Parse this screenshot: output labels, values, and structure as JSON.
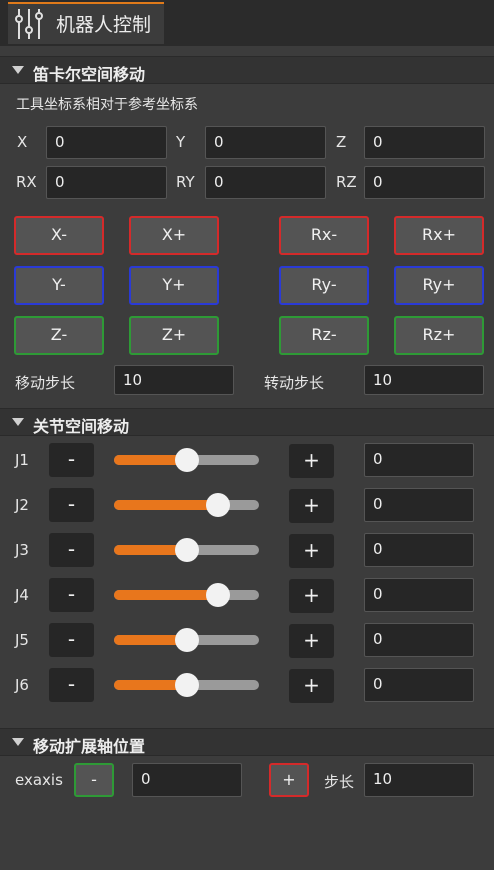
{
  "window": {
    "tab_title": "机器人控制"
  },
  "cartesian": {
    "title": "笛卡尔空间移动",
    "subtitle": "工具坐标系相对于参考坐标系",
    "coords": [
      {
        "label": "X",
        "value": "0"
      },
      {
        "label": "Y",
        "value": "0"
      },
      {
        "label": "Z",
        "value": "0"
      },
      {
        "label": "RX",
        "value": "0"
      },
      {
        "label": "RY",
        "value": "0"
      },
      {
        "label": "RZ",
        "value": "0"
      }
    ],
    "buttons": {
      "x_minus": "X-",
      "x_plus": "X+",
      "rx_minus": "Rx-",
      "rx_plus": "Rx+",
      "y_minus": "Y-",
      "y_plus": "Y+",
      "ry_minus": "Ry-",
      "ry_plus": "Ry+",
      "z_minus": "Z-",
      "z_plus": "Z+",
      "rz_minus": "Rz-",
      "rz_plus": "Rz+"
    },
    "move_step_label": "移动步长",
    "move_step_value": "10",
    "rotate_step_label": "转动步长",
    "rotate_step_value": "10"
  },
  "joint": {
    "title": "关节空间移动",
    "minus_label": "-",
    "plus_label": "+",
    "joints": [
      {
        "label": "J1",
        "value": "0",
        "slider_fraction": 0.5
      },
      {
        "label": "J2",
        "value": "0",
        "slider_fraction": 0.72
      },
      {
        "label": "J3",
        "value": "0",
        "slider_fraction": 0.5
      },
      {
        "label": "J4",
        "value": "0",
        "slider_fraction": 0.72
      },
      {
        "label": "J5",
        "value": "0",
        "slider_fraction": 0.5
      },
      {
        "label": "J6",
        "value": "0",
        "slider_fraction": 0.5
      }
    ]
  },
  "external_axis": {
    "title": "移动扩展轴位置",
    "label": "exaxis",
    "minus_label": "-",
    "plus_label": "+",
    "value": "0",
    "step_label": "步长",
    "step_value": "10"
  },
  "colors": {
    "accent_orange": "#e8761c",
    "red_border": "#d42a2a",
    "blue_border": "#2a3ad6",
    "green_border": "#2e9a36"
  },
  "icons": {
    "tab_icon": "sliders-icon",
    "collapse_icon": "triangle-down-icon"
  }
}
